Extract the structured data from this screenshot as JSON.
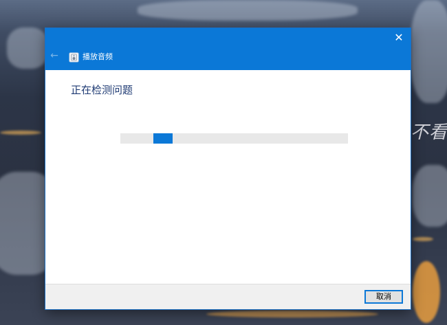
{
  "window": {
    "title": "播放音频",
    "close_glyph": "✕",
    "back_glyph": "←",
    "app_icon": "audio-troubleshooter-icon",
    "accent_color": "#0b78d7"
  },
  "main": {
    "heading": "正在检测问题",
    "progress": {
      "type": "indeterminate",
      "chunk_start_fraction": 0.145,
      "chunk_width_fraction": 0.085,
      "track_color": "#e8e8e8",
      "fill_color": "#0b78d7"
    }
  },
  "footer": {
    "cancel_label": "取消"
  },
  "desktop": {
    "wallpaper_text": "不看风"
  }
}
